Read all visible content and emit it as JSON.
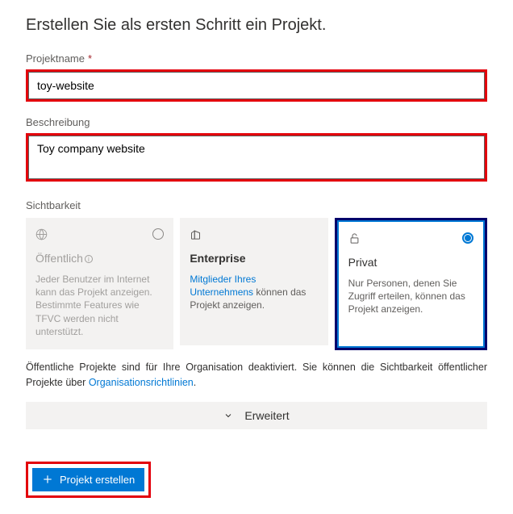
{
  "title": "Erstellen Sie als ersten Schritt ein Projekt.",
  "project_name": {
    "label": "Projektname",
    "required_marker": "*",
    "value": "toy-website"
  },
  "description": {
    "label": "Beschreibung",
    "value": "Toy company website"
  },
  "visibility": {
    "label": "Sichtbarkeit",
    "options": {
      "public": {
        "title": "Öffentlich",
        "desc": "Jeder Benutzer im Internet kann das Projekt anzeigen. Bestimmte Features wie TFVC werden nicht unterstützt.",
        "enabled": false,
        "selected": false
      },
      "enterprise": {
        "title": "Enterprise",
        "desc_link": "Mitglieder Ihres Unternehmens",
        "desc_rest": " können das Projekt anzeigen.",
        "enabled": true,
        "selected": false
      },
      "private": {
        "title": "Privat",
        "desc": "Nur Personen, denen Sie Zugriff erteilen, können das Projekt anzeigen.",
        "enabled": true,
        "selected": true
      }
    }
  },
  "public_notice": {
    "text_before": "Öffentliche Projekte sind für Ihre Organisation deaktiviert. Sie können die Sichtbarkeit öffentlicher Projekte über ",
    "link": "Organisationsrichtlinien",
    "text_after": "."
  },
  "advanced_label": "Erweitert",
  "create_button": "Projekt erstellen"
}
